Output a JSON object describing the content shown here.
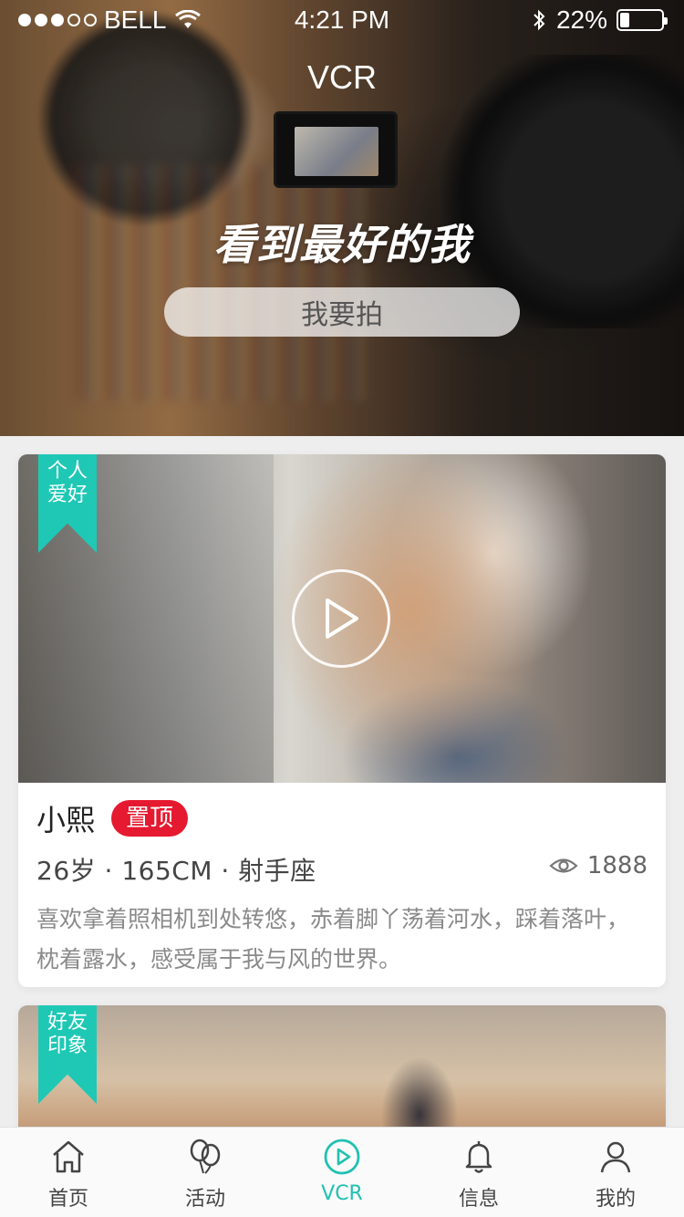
{
  "status_bar": {
    "carrier": "BELL",
    "time": "4:21 PM",
    "battery": "22%"
  },
  "hero": {
    "title": "VCR",
    "slogan": "看到最好的我",
    "cta_label": "我要拍"
  },
  "cards": [
    {
      "tag_line1": "个人",
      "tag_line2": "爱好",
      "name": "小熙",
      "badge": "置顶",
      "meta": "26岁 · 165CM · 射手座",
      "views": "1888",
      "description": "喜欢拿着照相机到处转悠，赤着脚丫荡着河水，踩着落叶，枕着露水，感受属于我与风的世界。"
    },
    {
      "tag_line1": "好友",
      "tag_line2": "印象"
    }
  ],
  "tabbar": {
    "items": [
      {
        "label": "首页",
        "icon": "home-icon"
      },
      {
        "label": "活动",
        "icon": "balloons-icon"
      },
      {
        "label": "VCR",
        "icon": "play-circle-icon",
        "active": true
      },
      {
        "label": "信息",
        "icon": "bell-icon"
      },
      {
        "label": "我的",
        "icon": "user-icon"
      }
    ]
  },
  "colors": {
    "accent": "#21c1b1",
    "ribbon": "#1fc8b5",
    "badge": "#e5192f"
  }
}
